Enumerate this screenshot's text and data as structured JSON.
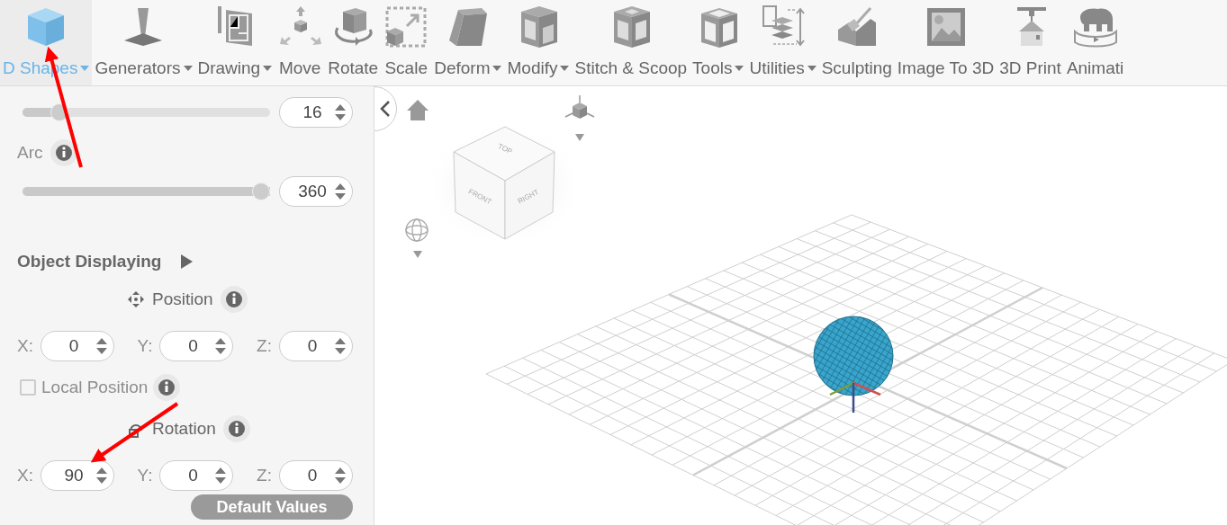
{
  "toolbar": {
    "items": [
      {
        "label": "D Shapes",
        "dropdown": true,
        "selected": true
      },
      {
        "label": "Generators",
        "dropdown": true,
        "selected": false
      },
      {
        "label": "Drawing",
        "dropdown": true,
        "selected": false
      },
      {
        "label": "Move",
        "dropdown": false,
        "selected": false
      },
      {
        "label": "Rotate",
        "dropdown": false,
        "selected": false
      },
      {
        "label": "Scale",
        "dropdown": false,
        "selected": false
      },
      {
        "label": "Deform",
        "dropdown": true,
        "selected": false
      },
      {
        "label": "Modify",
        "dropdown": true,
        "selected": false
      },
      {
        "label": "Stitch & Scoop",
        "dropdown": false,
        "selected": false
      },
      {
        "label": "Tools",
        "dropdown": true,
        "selected": false
      },
      {
        "label": "Utilities",
        "dropdown": true,
        "selected": false
      },
      {
        "label": "Sculpting",
        "dropdown": false,
        "selected": false
      },
      {
        "label": "Image To 3D",
        "dropdown": false,
        "selected": false
      },
      {
        "label": "3D Print",
        "dropdown": false,
        "selected": false
      },
      {
        "label": "Animati",
        "dropdown": false,
        "selected": false
      }
    ]
  },
  "panel": {
    "segments": {
      "level": 0.12,
      "value": "16"
    },
    "arc": {
      "label": "Arc",
      "disabled": true,
      "level": 1,
      "value": "360"
    },
    "object_displaying": {
      "title": "Object Displaying",
      "expanded": false
    },
    "position": {
      "title": "Position",
      "fields": [
        {
          "axis": "X:",
          "value": "0"
        },
        {
          "axis": "Y:",
          "value": "0"
        },
        {
          "axis": "Z:",
          "value": "0"
        }
      ]
    },
    "local_position": {
      "label": "Local Position",
      "checked": false,
      "disabled": true
    },
    "rotation": {
      "title": "Rotation",
      "fields": [
        {
          "axis": "X:",
          "value": "90"
        },
        {
          "axis": "Y:",
          "value": "0"
        },
        {
          "axis": "Z:",
          "value": "0"
        }
      ]
    },
    "default_button": {
      "label": "Default Values",
      "disabled": true
    }
  },
  "viewport": {
    "view_cube": {
      "faces": [
        "TOP",
        "FRONT",
        "RIGHT"
      ]
    }
  }
}
